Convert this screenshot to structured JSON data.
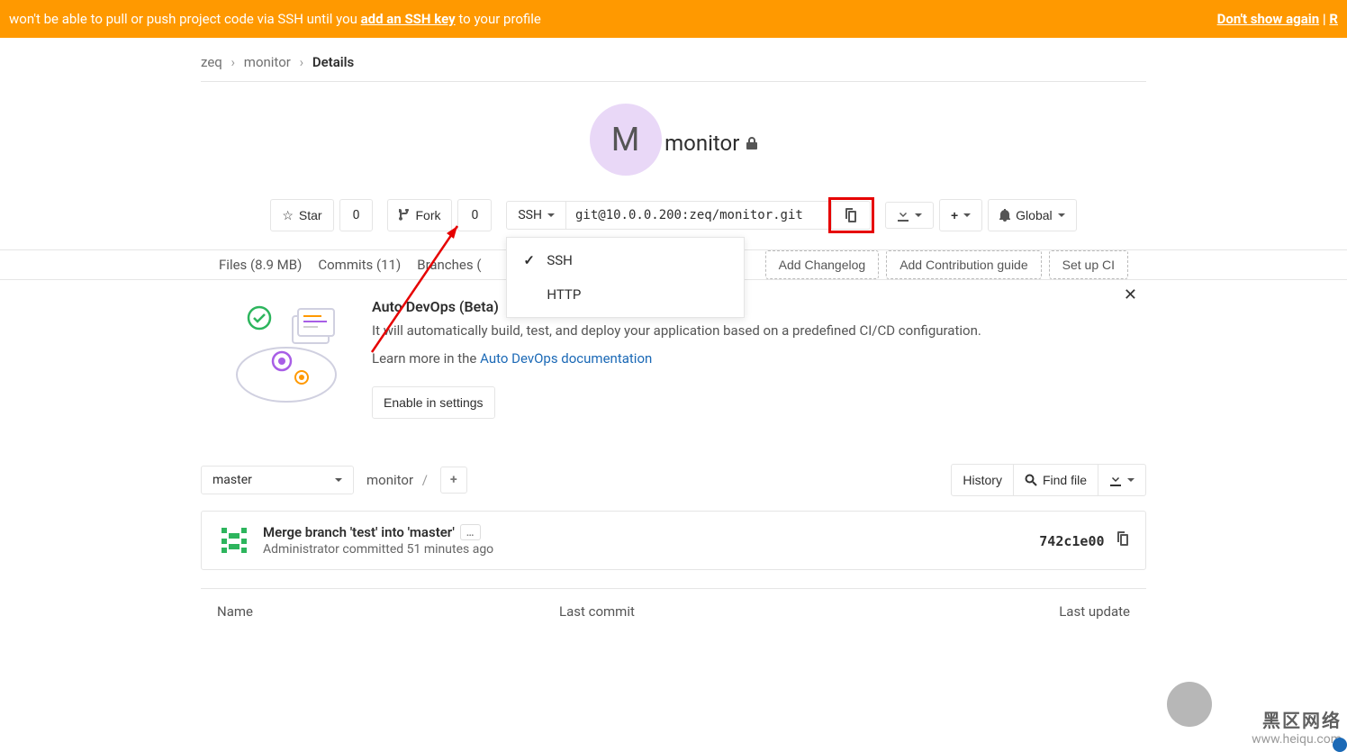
{
  "banner": {
    "text_prefix": "won't be able to pull or push project code via SSH until you ",
    "link_text": "add an SSH key",
    "text_suffix": " to your profile",
    "dont_show": "Don't show again",
    "remind": "R"
  },
  "breadcrumb": {
    "group": "zeq",
    "project": "monitor",
    "page": "Details"
  },
  "project": {
    "initial": "M",
    "name": "monitor"
  },
  "actions": {
    "star": "Star",
    "star_count": "0",
    "fork": "Fork",
    "fork_count": "0",
    "protocol": "SSH",
    "clone_url": "git@10.0.0.200:zeq/monitor.git",
    "global": "Global"
  },
  "protocol_menu": {
    "ssh": "SSH",
    "http": "HTTP"
  },
  "stats": {
    "files": "Files (8.9 MB)",
    "commits": "Commits (11)",
    "branches": "Branches (",
    "add_changelog": "Add Changelog",
    "add_contrib": "Add Contribution guide",
    "setup_ci": "Set up CI"
  },
  "devops": {
    "title": "Auto DevOps (Beta)",
    "desc": "It will automatically build, test, and deploy your application based on a predefined CI/CD configuration.",
    "learn_prefix": "Learn more in the ",
    "learn_link": "Auto DevOps documentation",
    "enable": "Enable in settings"
  },
  "file_toolbar": {
    "branch": "master",
    "path": "monitor",
    "history": "History",
    "find": "Find file"
  },
  "last_commit": {
    "message": "Merge branch 'test' into 'master'",
    "author": "Administrator",
    "verb": "committed",
    "when": "51 minutes ago",
    "sha": "742c1e00"
  },
  "table": {
    "name": "Name",
    "last_commit": "Last commit",
    "last_update": "Last update"
  },
  "watermark": {
    "cn": "黑区网络",
    "url": "www.heiqu.com"
  }
}
